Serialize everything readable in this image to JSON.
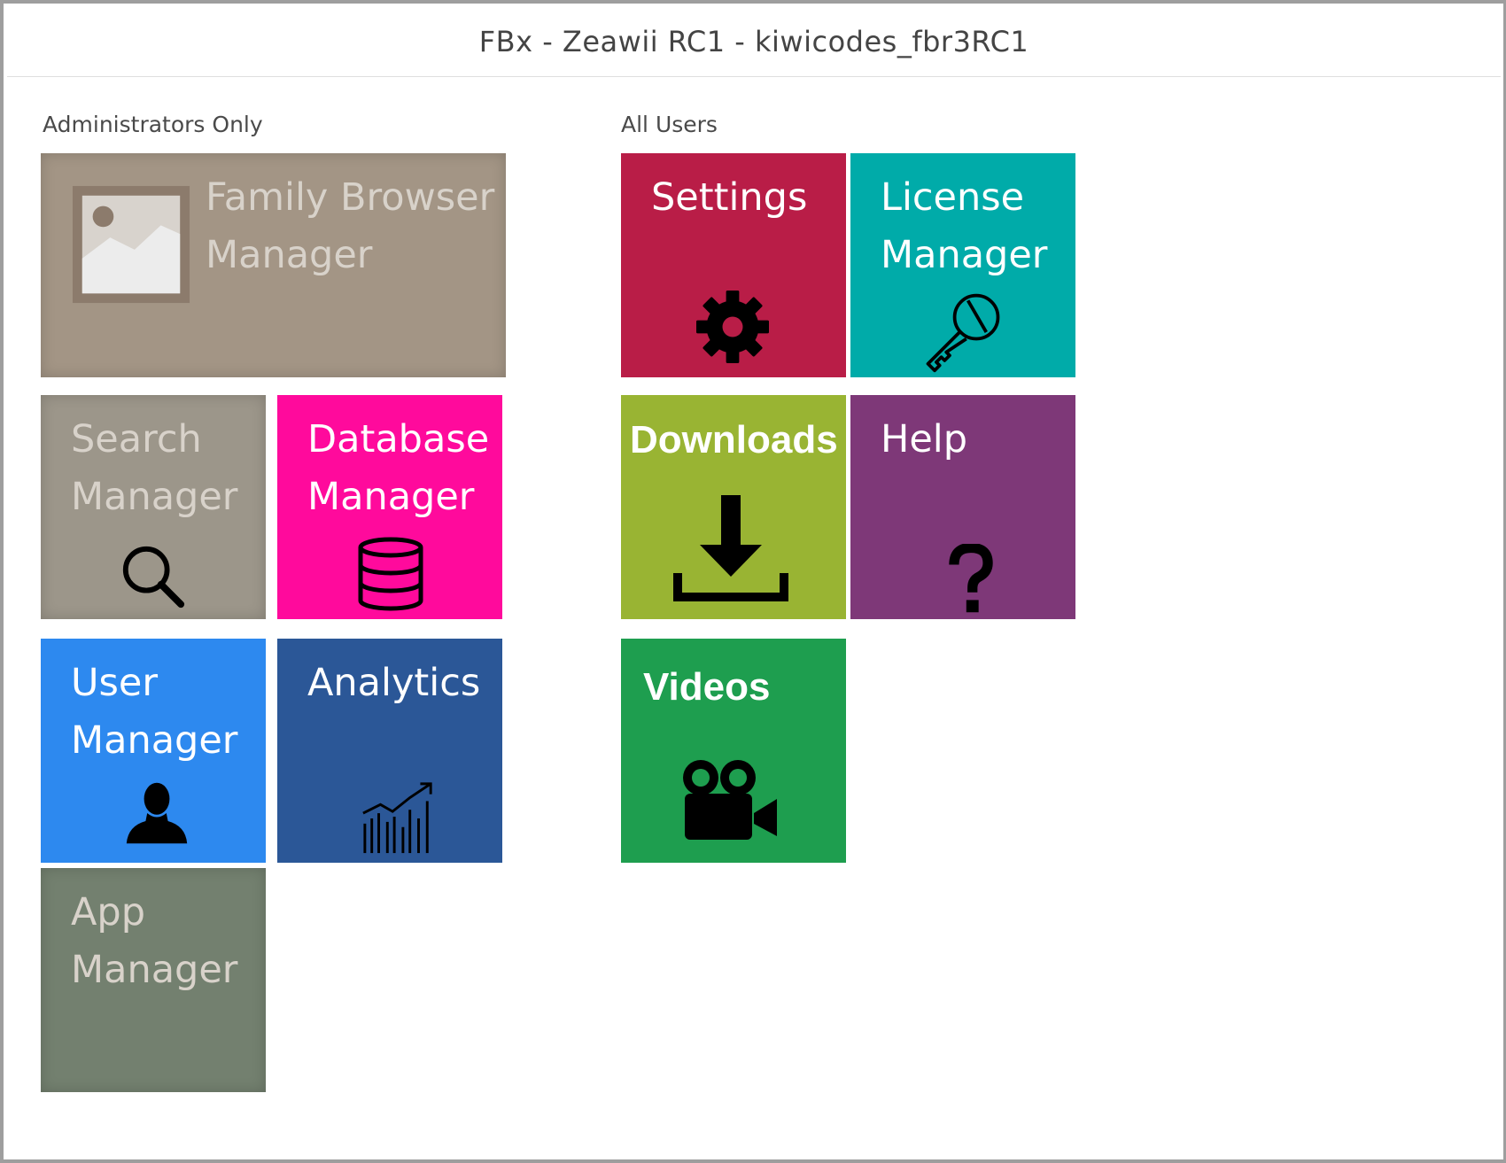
{
  "window": {
    "title": "FBx - Zeawii RC1 - kiwicodes_fbr3RC1"
  },
  "sections": {
    "admin": {
      "label": "Administrators Only"
    },
    "all": {
      "label": "All Users"
    }
  },
  "admin_tiles": {
    "family_browser": {
      "label": "Family Browser\nManager",
      "icon": "picture-icon",
      "color": "#a39585",
      "disabled": true
    },
    "search_manager": {
      "label": "Search\nManager",
      "icon": "search-icon",
      "color": "#9c968a",
      "disabled": true
    },
    "database_manager": {
      "label": "Database\nManager",
      "icon": "database-icon",
      "color": "#ff0a9c"
    },
    "user_manager": {
      "label": "User\nManager",
      "icon": "user-icon",
      "color": "#2d89ef"
    },
    "analytics": {
      "label": "Analytics",
      "icon": "chart-icon",
      "color": "#2b5797"
    },
    "app_manager": {
      "label": "App\nManager",
      "icon": "",
      "color": "#73806f",
      "disabled": true
    }
  },
  "user_tiles": {
    "settings": {
      "label": "Settings",
      "icon": "gear-icon",
      "color": "#b91d47"
    },
    "license_manager": {
      "label": "License\nManager",
      "icon": "key-icon",
      "color": "#00aba9"
    },
    "downloads": {
      "label": "Downloads",
      "icon": "download-icon",
      "color": "#99b433"
    },
    "help": {
      "label": "Help",
      "icon": "question-icon",
      "color": "#7e3878"
    },
    "videos": {
      "label": "Videos",
      "icon": "video-camera-icon",
      "color": "#1e9e4f"
    }
  }
}
